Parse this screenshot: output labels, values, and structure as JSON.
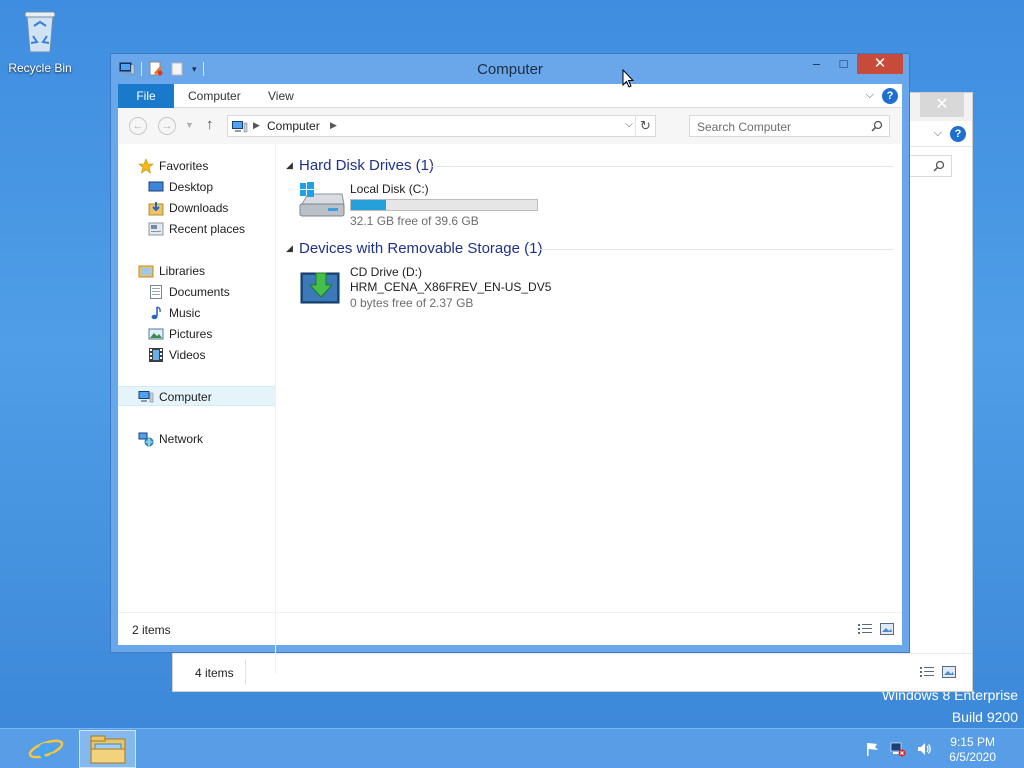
{
  "desktop": {
    "recycle_bin_label": "Recycle Bin",
    "watermark_line1": "Windows 8 Enterprise",
    "watermark_line2": "Build 9200"
  },
  "background_window": {
    "status_count": "4 items"
  },
  "window": {
    "title": "Computer",
    "ribbon_tabs": [
      {
        "label": "File"
      },
      {
        "label": "Computer"
      },
      {
        "label": "View"
      }
    ],
    "address": {
      "crumbs": [
        "Computer"
      ]
    },
    "search": {
      "placeholder": "Search Computer"
    },
    "sidebar": {
      "favorites": {
        "label": "Favorites",
        "items": [
          {
            "label": "Desktop",
            "icon": "desktop-icon"
          },
          {
            "label": "Downloads",
            "icon": "downloads-icon"
          },
          {
            "label": "Recent places",
            "icon": "recent-places-icon"
          }
        ]
      },
      "libraries": {
        "label": "Libraries",
        "items": [
          {
            "label": "Documents",
            "icon": "documents-icon"
          },
          {
            "label": "Music",
            "icon": "music-icon"
          },
          {
            "label": "Pictures",
            "icon": "pictures-icon"
          },
          {
            "label": "Videos",
            "icon": "videos-icon"
          }
        ]
      },
      "computer": {
        "label": "Computer",
        "selected": true
      },
      "network": {
        "label": "Network"
      }
    },
    "groups": [
      {
        "title": "Hard Disk Drives (1)",
        "drives": [
          {
            "name": "Local Disk (C:)",
            "free_text": "32.1 GB free of 39.6 GB",
            "used_fraction": 0.19
          }
        ]
      },
      {
        "title": "Devices with Removable Storage (1)",
        "drives": [
          {
            "name": "CD Drive (D:)",
            "label": "HRM_CENA_X86FREV_EN-US_DV5",
            "free_text": "0 bytes free of 2.37 GB"
          }
        ]
      }
    ],
    "status_count": "2 items"
  },
  "taskbar": {
    "time": "9:15 PM",
    "date": "6/5/2020"
  },
  "colors": {
    "accent": "#1979ca",
    "group_header": "#1e3287",
    "capacity_bar": "#26a0da",
    "close_button": "#c74a3b"
  }
}
